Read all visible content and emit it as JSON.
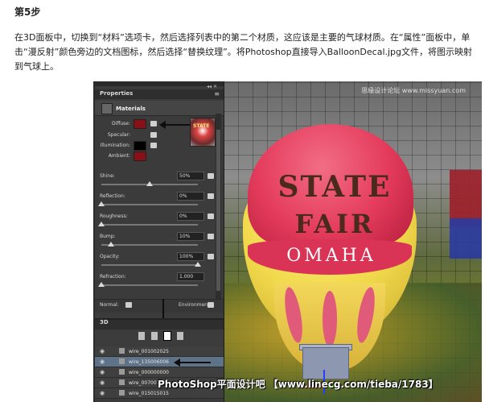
{
  "article": {
    "step_title": "第5步",
    "paragraph": "在3D面板中，切换到“材料”选项卡，然后选择列表中的第二个材质，这应该是主要的气球材质。在“属性”面板中，单击“漫反射”颜色旁边的文档图标，然后选择“替换纹理”。将Photoshop直接导入BalloonDecal.jpg文件，将图示映射到气球上。"
  },
  "screenshot": {
    "watermark": "思缘设计论坛 www.missyuan.com",
    "banner": "PhotoShop平面设计吧 【www.linecg.com/tieba/1783】",
    "balloon_text": {
      "line1": "STATE",
      "line2": "FAIR",
      "line3": "OMAHA"
    },
    "properties_panel": {
      "tab_label": "Properties",
      "section_title": "Materials",
      "preview_text": "STATE",
      "colors": [
        {
          "label": "Diffuse:",
          "swatch": "#8a0f16"
        },
        {
          "label": "Specular:",
          "swatch": ""
        },
        {
          "label": "Illumination:",
          "swatch": "#000000"
        },
        {
          "label": "Ambient:",
          "swatch": "#8a0f16"
        }
      ],
      "sliders": [
        {
          "label": "Shine:",
          "value": "50%",
          "level": 0.5
        },
        {
          "label": "Reflection:",
          "value": "0%",
          "level": 0.0
        },
        {
          "label": "Roughness:",
          "value": "0%",
          "level": 0.0
        },
        {
          "label": "Bump:",
          "value": "10%",
          "level": 0.1
        },
        {
          "label": "Opacity:",
          "value": "100%",
          "level": 1.0
        },
        {
          "label": "Refraction:",
          "value": "1.000",
          "level": 0.0
        }
      ],
      "normal_label": "Normal:",
      "environment_label": "Environment:"
    },
    "panel_3d": {
      "header": "3D",
      "layers": [
        {
          "name": "wire_001002025",
          "selected": false
        },
        {
          "name": "wire_135006006",
          "selected": true
        },
        {
          "name": "wire_000000000",
          "selected": false
        },
        {
          "name": "wire_007007",
          "selected": false
        },
        {
          "name": "wire_015015015",
          "selected": false
        }
      ]
    }
  }
}
